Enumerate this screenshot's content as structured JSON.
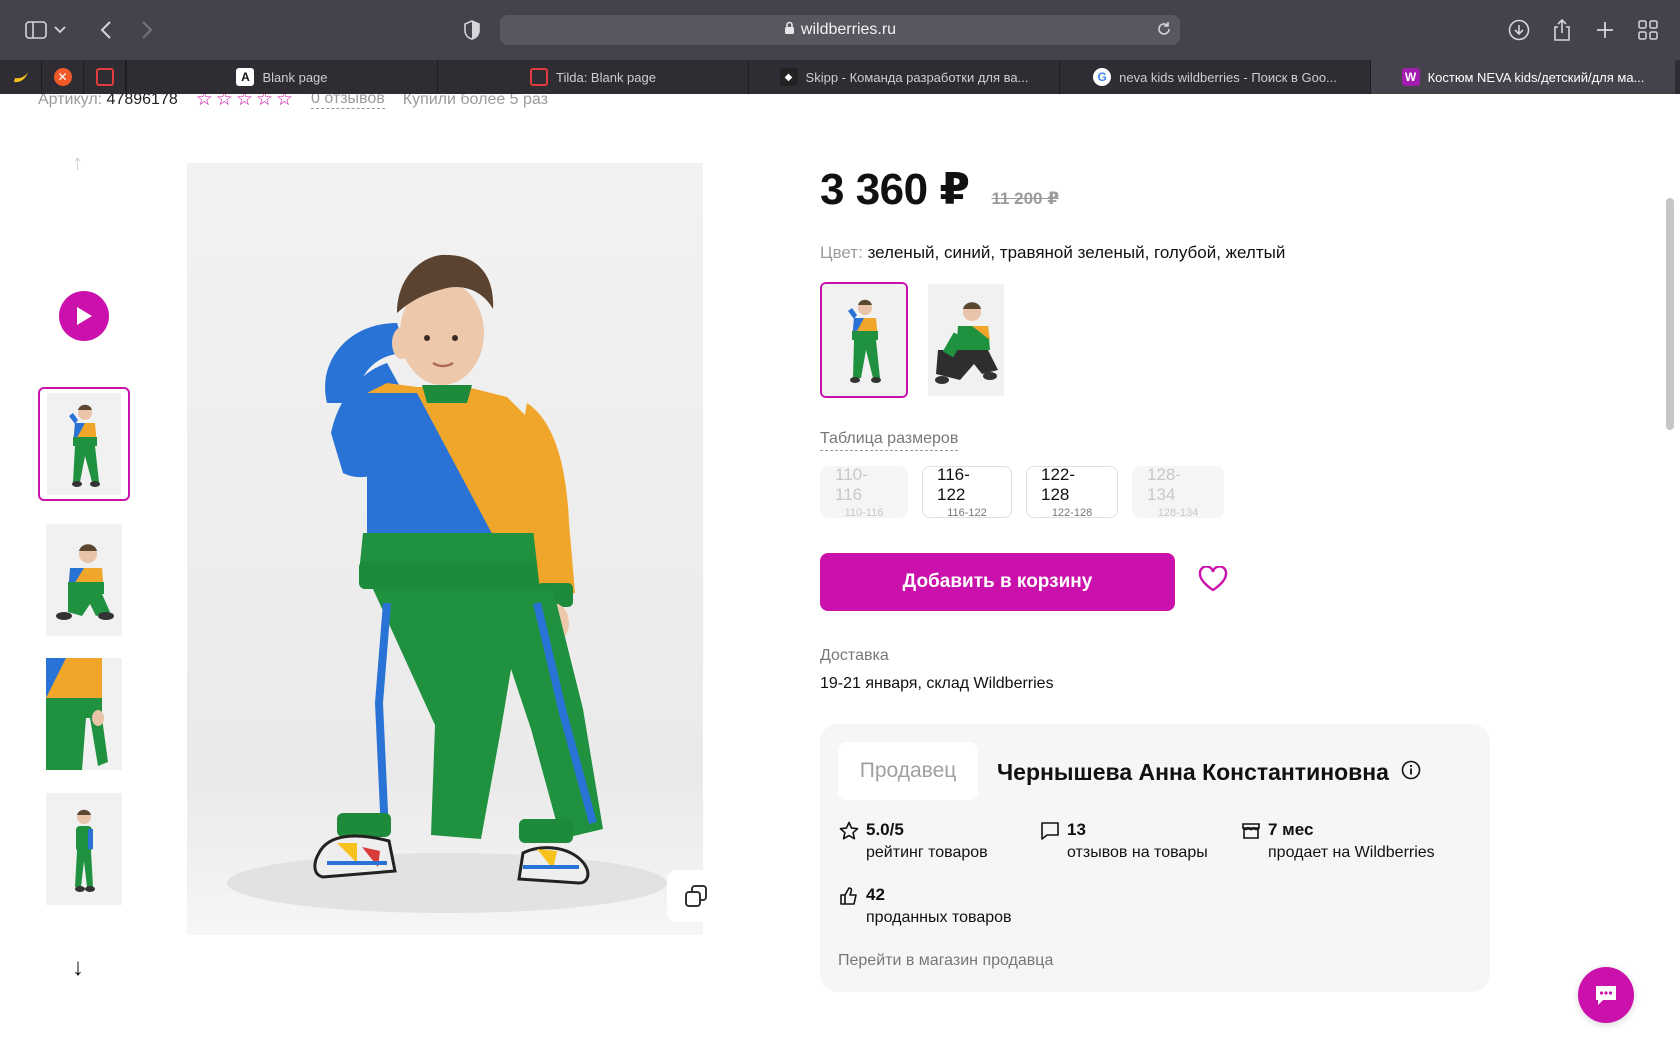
{
  "browser": {
    "url": "wildberries.ru",
    "tabs": [
      {
        "title": "Blank page",
        "favicon": "a-icon"
      },
      {
        "title": "Tilda: Blank page",
        "favicon": "tilda-icon"
      },
      {
        "title": "Skipp - Команда разработки для ва...",
        "favicon": "skipp-icon"
      },
      {
        "title": "neva kids wildberries - Поиск в Goo...",
        "favicon": "google-icon"
      },
      {
        "title": "Костюм NEVA kids/детский/для ма...",
        "favicon": "wb-icon"
      }
    ]
  },
  "product": {
    "article_label": "Артикул:",
    "article_value": "47896178",
    "reviews_link": "0 отзывов",
    "bought": "Купили более 5 раз",
    "price_now": "3 360 ₽",
    "price_old": "11 200 ₽",
    "color_label": "Цвет:",
    "color_value": "зеленый, синий, травяной зеленый, голубой, желтый",
    "size_table_link": "Таблица размеров",
    "sizes": [
      {
        "label": "110-116",
        "sub": "110-116",
        "available": false
      },
      {
        "label": "116-122",
        "sub": "116-122",
        "available": true
      },
      {
        "label": "122-128",
        "sub": "122-128",
        "available": true
      },
      {
        "label": "128-134",
        "sub": "128-134",
        "available": false
      }
    ],
    "add_to_cart": "Добавить в корзину",
    "delivery_label": "Доставка",
    "delivery_value": "19-21 января, склад Wildberries"
  },
  "seller": {
    "tag": "Продавец",
    "name": "Чернышева Анна Константиновна",
    "stats": [
      {
        "icon": "star-icon",
        "value": "5.0/5",
        "label": "рейтинг товаров"
      },
      {
        "icon": "comment-icon",
        "value": "13",
        "label": "отзывов на товары"
      },
      {
        "icon": "store-icon",
        "value": "7 мес",
        "label": "продает на Wildberries"
      },
      {
        "icon": "thumbs-up-icon",
        "value": "42",
        "label": "проданных товаров"
      }
    ],
    "link": "Перейти в магазин продавца"
  },
  "colors": {
    "accent": "#cb11ab",
    "orange": "#f0a62a",
    "blue": "#2a73d6",
    "green": "#20913f"
  }
}
